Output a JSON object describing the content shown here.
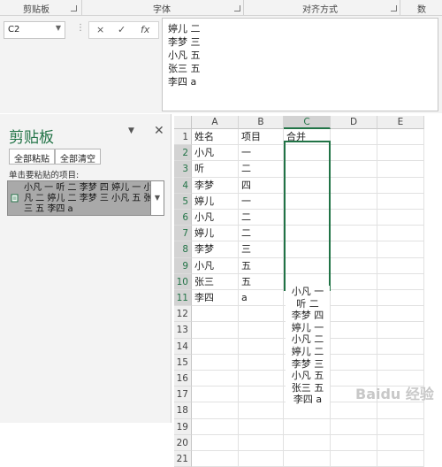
{
  "ribbon": {
    "groups": [
      "剪贴板",
      "字体",
      "对齐方式",
      "数"
    ]
  },
  "formula_bar": {
    "name_box": "C2",
    "cancel_icon": "×",
    "enter_icon": "✓",
    "fx_label": "fx",
    "lines": [
      "婷儿 二",
      "李梦 三",
      "小凡 五",
      "张三 五",
      "李四 a"
    ]
  },
  "clipboard": {
    "title": "剪贴板",
    "paste_all": "全部粘贴",
    "clear_all": "全部清空",
    "hint": "单击要粘贴的项目:",
    "item_text": "小凡 一 听 二 李梦 四 婷儿 一 小凡 二 婷儿 二 李梦 三 小凡 五 张三 五 李四 a"
  },
  "sheet": {
    "columns": [
      "A",
      "B",
      "C",
      "D",
      "E"
    ],
    "selected_column": "C",
    "rows": [
      {
        "n": "1",
        "a": "姓名",
        "b": "项目",
        "c": "合并"
      },
      {
        "n": "2",
        "a": "小凡",
        "b": "一",
        "c": ""
      },
      {
        "n": "3",
        "a": "听",
        "b": "二",
        "c": ""
      },
      {
        "n": "4",
        "a": "李梦",
        "b": "四",
        "c": ""
      },
      {
        "n": "5",
        "a": "婷儿",
        "b": "一",
        "c": ""
      },
      {
        "n": "6",
        "a": "小凡",
        "b": "二",
        "c": ""
      },
      {
        "n": "7",
        "a": "婷儿",
        "b": "二",
        "c": ""
      },
      {
        "n": "8",
        "a": "李梦",
        "b": "三",
        "c": ""
      },
      {
        "n": "9",
        "a": "小凡",
        "b": "五",
        "c": ""
      },
      {
        "n": "10",
        "a": "张三",
        "b": "五",
        "c": ""
      },
      {
        "n": "11",
        "a": "李四",
        "b": "a",
        "c": ""
      },
      {
        "n": "12",
        "a": "",
        "b": "",
        "c": ""
      },
      {
        "n": "13",
        "a": "",
        "b": "",
        "c": ""
      },
      {
        "n": "14",
        "a": "",
        "b": "",
        "c": ""
      },
      {
        "n": "15",
        "a": "",
        "b": "",
        "c": ""
      },
      {
        "n": "16",
        "a": "",
        "b": "",
        "c": ""
      },
      {
        "n": "17",
        "a": "",
        "b": "",
        "c": ""
      },
      {
        "n": "18",
        "a": "",
        "b": "",
        "c": ""
      },
      {
        "n": "19",
        "a": "",
        "b": "",
        "c": ""
      },
      {
        "n": "20",
        "a": "",
        "b": "",
        "c": ""
      },
      {
        "n": "21",
        "a": "",
        "b": "",
        "c": ""
      }
    ],
    "c_overflow_lines": [
      "小凡 一",
      "听 二",
      "李梦 四",
      "婷儿 一",
      "小凡 二",
      "婷儿 二",
      "李梦 三",
      "小凡 五",
      "张三 五",
      "李四 a"
    ]
  },
  "watermark": "Baidu 经验",
  "colors": {
    "accent": "#217346"
  }
}
